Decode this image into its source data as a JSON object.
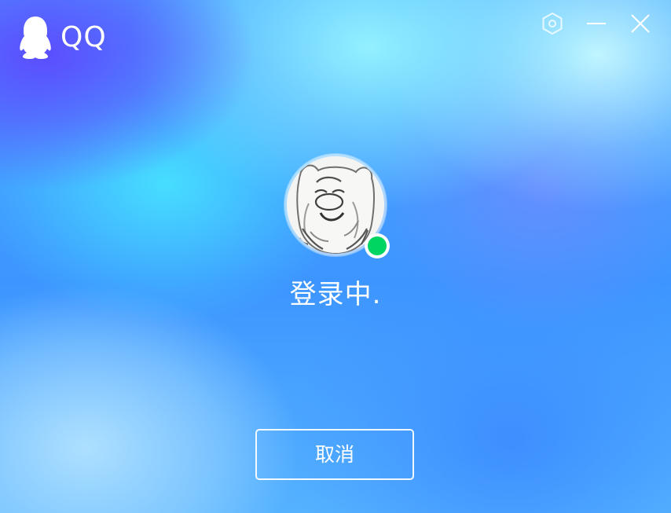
{
  "app": {
    "name": "QQ",
    "logo_icon": "qq-penguin-icon"
  },
  "window_controls": {
    "settings_icon": "settings-hexagon-icon",
    "minimize_icon": "minimize-icon",
    "close_icon": "close-icon"
  },
  "login": {
    "avatar_icon": "bear-avatar",
    "status": "online",
    "status_color": "#00d562",
    "status_text": "登录中."
  },
  "actions": {
    "cancel_label": "取消"
  },
  "colors": {
    "background_primary": "#3fa3ff",
    "background_highlight": "#5c48ff",
    "text": "#ffffff"
  }
}
